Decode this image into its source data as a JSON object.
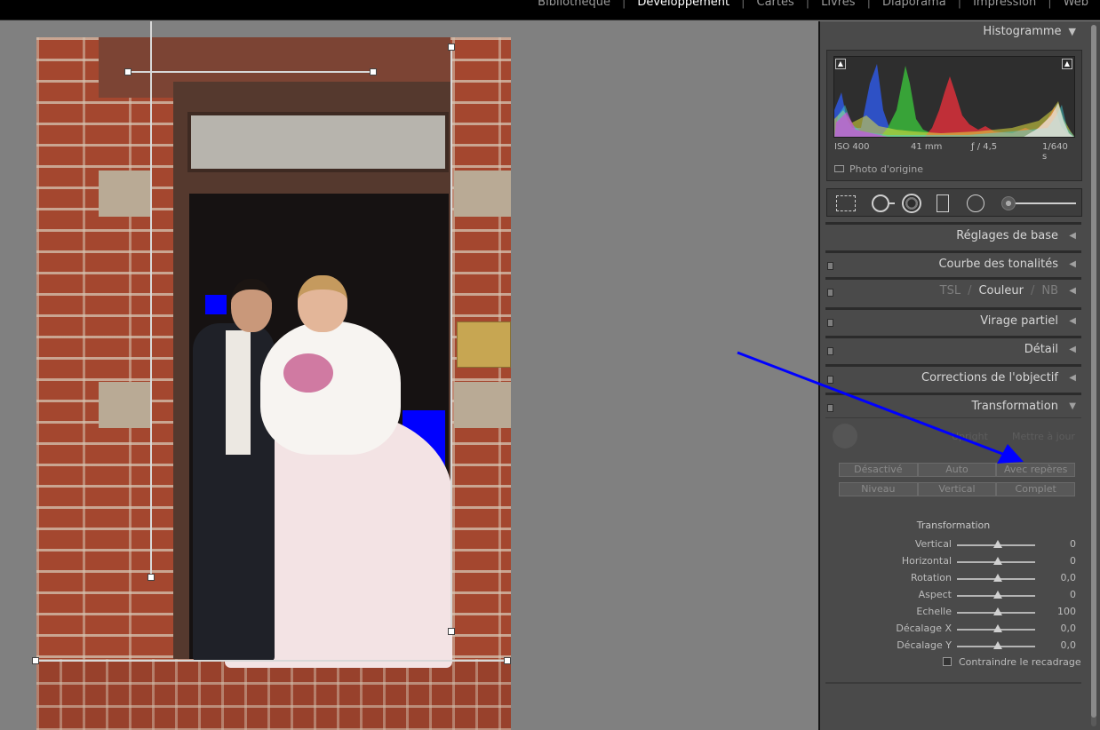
{
  "modules": [
    {
      "label": "Bibliothèque",
      "active": false
    },
    {
      "label": "Développement",
      "active": true
    },
    {
      "label": "Cartes",
      "active": false
    },
    {
      "label": "Livres",
      "active": false
    },
    {
      "label": "Diaporama",
      "active": false
    },
    {
      "label": "Impression",
      "active": false
    },
    {
      "label": "Web",
      "active": false
    }
  ],
  "histogram": {
    "title": "Histogramme",
    "iso": "ISO 400",
    "focal": "41 mm",
    "aperture": "ƒ / 4,5",
    "shutter": "1/640 s",
    "original_label": "Photo d'origine"
  },
  "plaque_text": "",
  "sections": {
    "basic": "Réglages de base",
    "tone_curve": "Courbe des tonalités",
    "hsl": {
      "tsl": "TSL",
      "sep": "/",
      "color": "Couleur",
      "nb": "NB"
    },
    "split_toning": "Virage partiel",
    "detail": "Détail",
    "lens": "Corrections de l'objectif",
    "transform": "Transformation"
  },
  "transform": {
    "upright_label": "Upright",
    "update_label": "Mettre à jour",
    "upright_buttons_row1": [
      "Désactivé",
      "Auto",
      "Avec repères"
    ],
    "upright_buttons_row2": [
      "Niveau",
      "Vertical",
      "Complet"
    ],
    "subsection_title": "Transformation",
    "sliders": [
      {
        "label": "Vertical",
        "value": "0"
      },
      {
        "label": "Horizontal",
        "value": "0"
      },
      {
        "label": "Rotation",
        "value": "0,0"
      },
      {
        "label": "Aspect",
        "value": "0"
      },
      {
        "label": "Echelle",
        "value": "100"
      },
      {
        "label": "Décalage X",
        "value": "0,0"
      },
      {
        "label": "Décalage Y",
        "value": "0,0"
      }
    ],
    "constrain_label": "Contraindre le recadrage"
  },
  "colors": {
    "annotation_arrow": "#0000ff",
    "highlight_clip": "#0000ff",
    "panel_bg": "#4a4a4a",
    "canvas_bg": "#808080"
  }
}
